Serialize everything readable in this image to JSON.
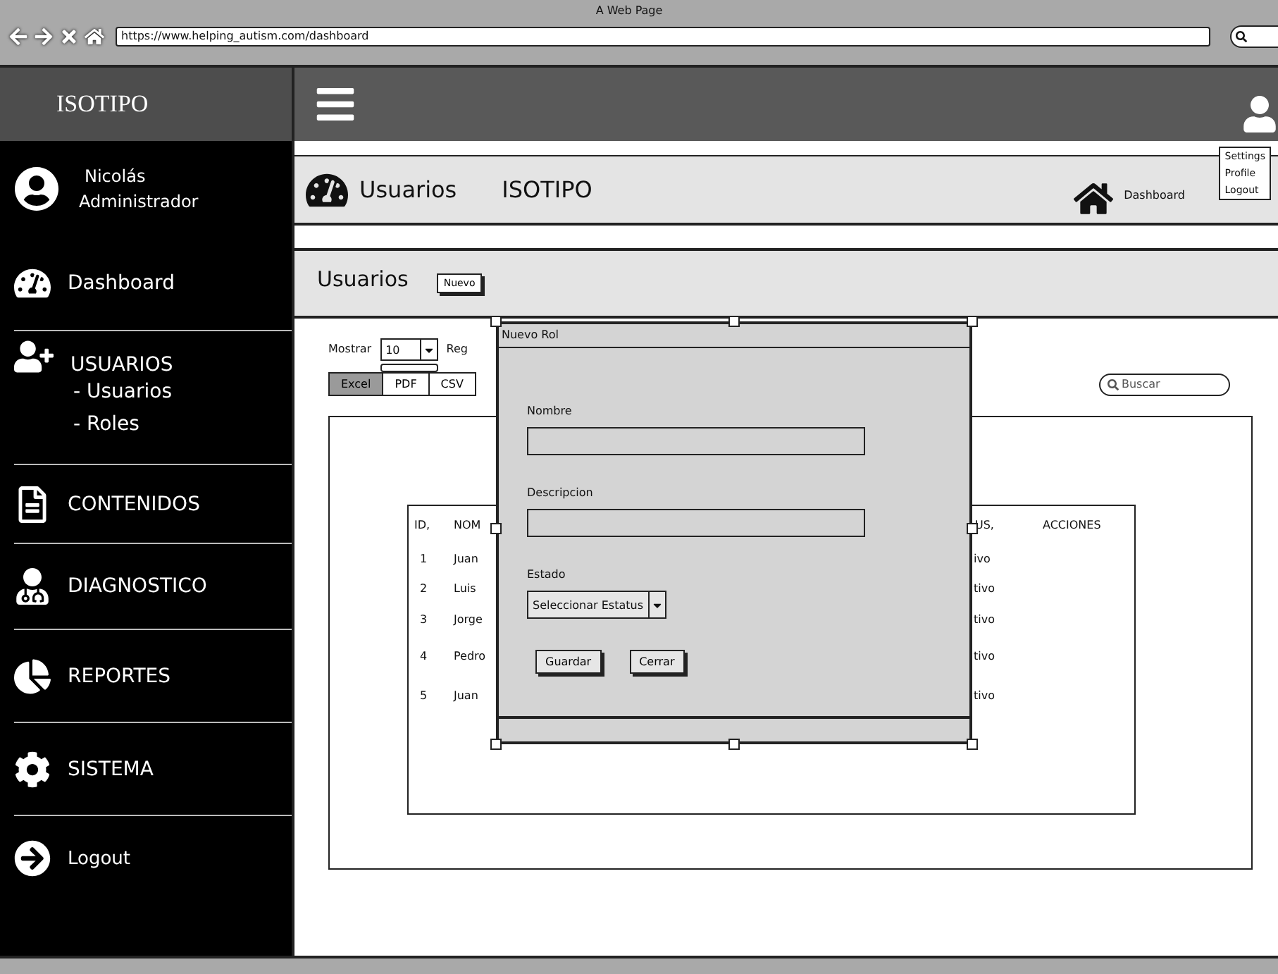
{
  "browser": {
    "title": "A Web Page",
    "url": "https://www.helping_autism.com/dashboard"
  },
  "sidebar": {
    "logo": "ISOTIPO",
    "user": {
      "name": "Nicolás",
      "role": "Administrador"
    },
    "items": [
      {
        "label": "Dashboard"
      },
      {
        "label": "USUARIOS",
        "children": [
          "- Usuarios",
          "- Roles"
        ]
      },
      {
        "label": "CONTENIDOS"
      },
      {
        "label": "DIAGNOSTICO"
      },
      {
        "label": "REPORTES"
      },
      {
        "label": "SISTEMA"
      },
      {
        "label": "Logout"
      }
    ]
  },
  "topbar": {
    "user_menu": [
      "Settings",
      "Profile",
      "Logout"
    ]
  },
  "header": {
    "title": "Usuarios",
    "brand": "ISOTIPO",
    "breadcrumb": "Dashboard"
  },
  "section": {
    "title": "Usuarios",
    "new_button": "Nuevo"
  },
  "controls": {
    "show_label": "Mostrar",
    "page_size": "10",
    "records_label": "Reg",
    "exports": [
      {
        "label": "Excel",
        "selected": true
      },
      {
        "label": "PDF",
        "selected": false
      },
      {
        "label": "CSV",
        "selected": false
      }
    ],
    "search": {
      "placeholder": "Buscar"
    }
  },
  "table": {
    "columns": [
      "ID,",
      "NOM",
      "US,",
      "ACCIONES"
    ],
    "rows": [
      {
        "id": "1",
        "name": "Juan",
        "status": "ivo"
      },
      {
        "id": "2",
        "name": "Luis",
        "status": "tivo"
      },
      {
        "id": "3",
        "name": "Jorge",
        "status": "tivo"
      },
      {
        "id": "4",
        "name": "Pedro",
        "status": "tivo"
      },
      {
        "id": "5",
        "name": "Juan",
        "status": "tivo"
      }
    ]
  },
  "modal": {
    "title": "Nuevo Rol",
    "fields": [
      {
        "kind": "text",
        "label": "Nombre"
      },
      {
        "kind": "text",
        "label": "Descripcion"
      },
      {
        "kind": "select",
        "label": "Estado",
        "value": "Seleccionar Estatus"
      }
    ],
    "buttons": [
      "Guardar",
      "Cerrar"
    ]
  }
}
